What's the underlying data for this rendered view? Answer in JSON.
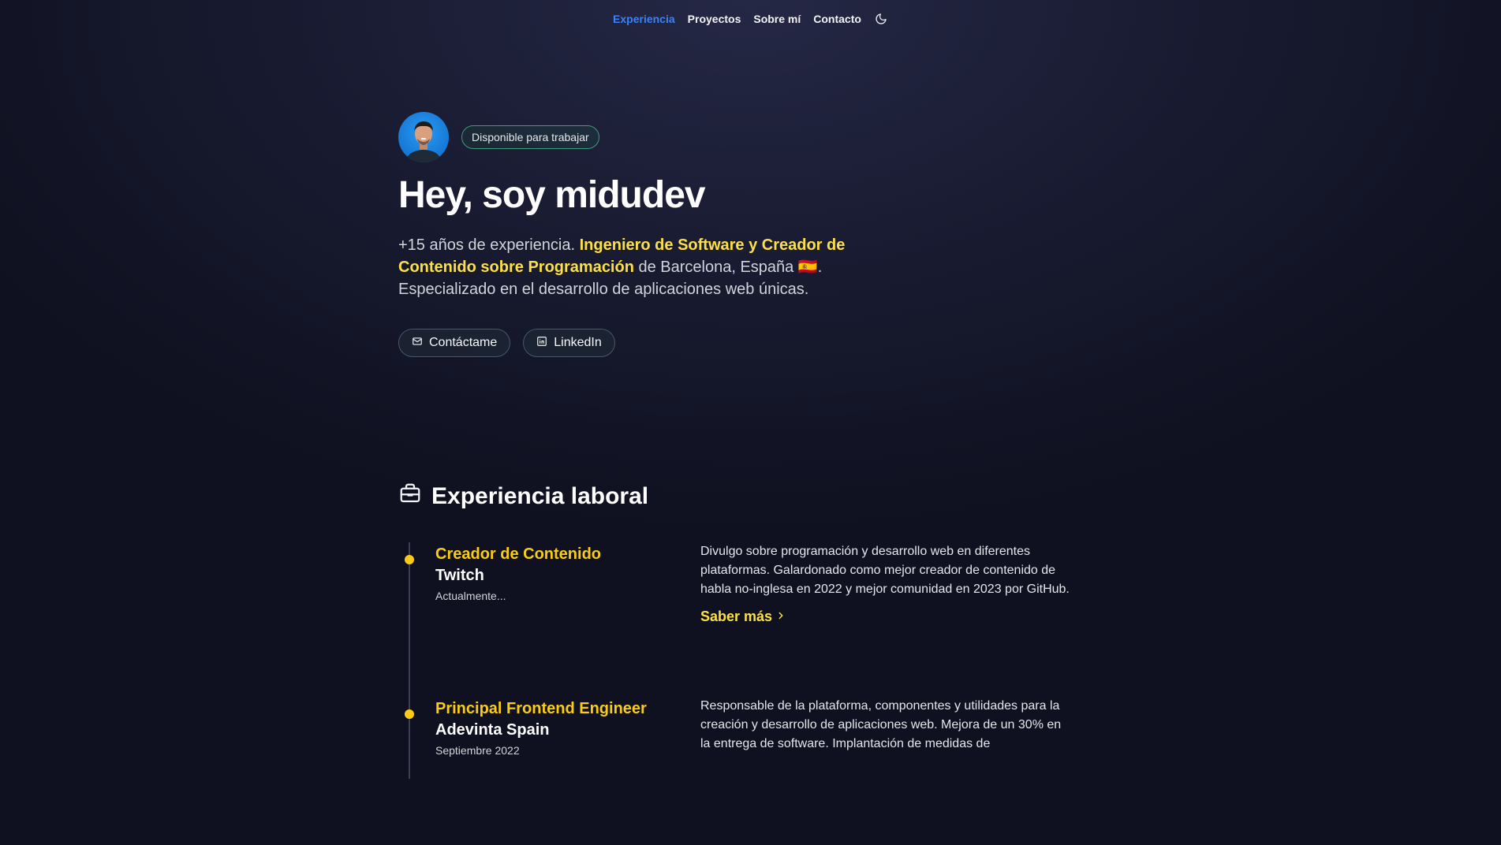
{
  "nav": {
    "items": [
      {
        "label": "Experiencia",
        "active": true
      },
      {
        "label": "Proyectos"
      },
      {
        "label": "Sobre mí"
      },
      {
        "label": "Contacto"
      }
    ],
    "theme_icon": "moon-icon"
  },
  "hero": {
    "avatar_alt": "avatar",
    "badge": "Disponible para trabajar",
    "title": "Hey, soy midudev",
    "intro_prefix": "+15 años de experiencia. ",
    "intro_highlight": "Ingeniero de Software y Creador de Contenido sobre Programación",
    "intro_mid": " de Barcelona, España ",
    "intro_flag": "🇪🇸",
    "intro_suffix": ". Especializado en el desarrollo de aplicaciones web únicas.",
    "buttons": [
      {
        "label": "Contáctame",
        "icon": "mail-icon"
      },
      {
        "label": "LinkedIn",
        "icon": "linkedin-icon"
      }
    ]
  },
  "experience": {
    "title": "Experiencia laboral",
    "icon": "briefcase-icon",
    "items": [
      {
        "role": "Creador de Contenido",
        "company": "Twitch",
        "date": "Actualmente...",
        "description": "Divulgo sobre programación y desarrollo web en diferentes plataformas. Galardonado como mejor creador de contenido de habla no-inglesa en 2022 y mejor comunidad en 2023 por GitHub.",
        "link": "Saber más"
      },
      {
        "role": "Principal Frontend Engineer",
        "company": "Adevinta Spain",
        "date": "Septiembre 2022",
        "description": "Responsable de la plataforma, componentes y utilidades para la creación y desarrollo de aplicaciones web. Mejora de un 30% en la entrega de software. Implantación de medidas de"
      }
    ]
  },
  "colors": {
    "accent_blue": "#3b82f6",
    "accent_yellow": "#facc15",
    "highlight": "#fde047",
    "background": "#0f1120"
  }
}
